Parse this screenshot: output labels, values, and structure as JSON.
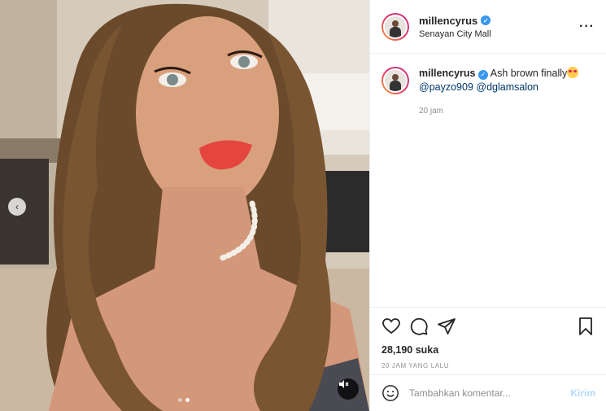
{
  "post": {
    "username": "millencyrus",
    "location": "Senayan City Mall",
    "caption_text": "Ash brown finally",
    "mentions": [
      "@payzo909",
      "@dglamsalon"
    ],
    "caption_time": "20 jam",
    "likes": "28,190 suka",
    "posted": "20 JAM YANG LALU"
  },
  "comment": {
    "placeholder": "Tambahkan komentar...",
    "send_label": "Kirim"
  },
  "icons": {
    "prev": "chevron-left-icon",
    "more": "more-options-icon",
    "like": "heart-icon",
    "comment": "comment-bubble-icon",
    "share": "paper-plane-icon",
    "save": "bookmark-icon",
    "emoji": "smiley-icon",
    "mute": "speaker-muted-icon"
  },
  "carousel": {
    "current": 2,
    "total": 2
  },
  "colors": {
    "link": "#00376b",
    "verified": "#3897f0",
    "send": "#b3dbff",
    "muted": "#8e8e8e"
  }
}
